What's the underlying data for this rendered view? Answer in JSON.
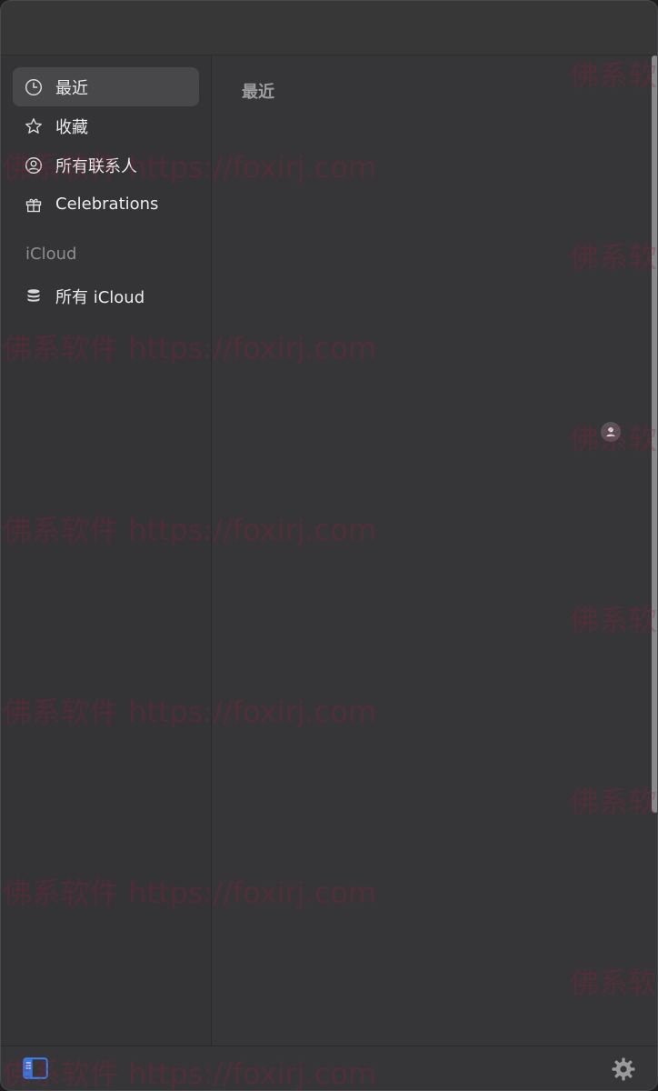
{
  "sidebar": {
    "items": [
      {
        "label": "最近",
        "icon": "clock-icon",
        "selected": true
      },
      {
        "label": "收藏",
        "icon": "star-icon",
        "selected": false
      },
      {
        "label": "所有联系人",
        "icon": "person-circle-icon",
        "selected": false
      },
      {
        "label": "Celebrations",
        "icon": "gift-icon",
        "selected": false
      }
    ],
    "section_header": "iCloud",
    "section_items": [
      {
        "label": "所有 iCloud",
        "icon": "database-icon"
      }
    ]
  },
  "content": {
    "title": "最近"
  },
  "watermark": {
    "text": "佛系软件 https://foxirj.com",
    "short_text": "佛系软"
  },
  "colors": {
    "window_bg": "#363638",
    "sidebar_bg": "#343436",
    "selected_bg": "#48484b",
    "accent": "#3b82f6",
    "watermark": "#961e3c"
  }
}
